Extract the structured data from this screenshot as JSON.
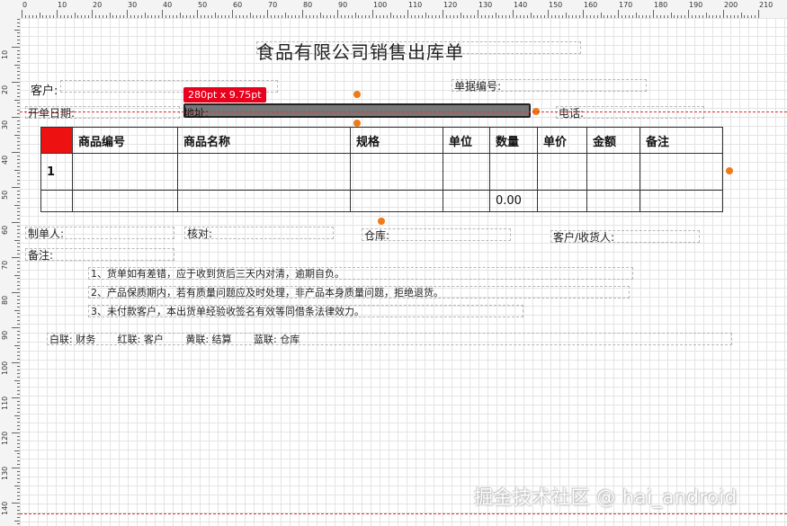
{
  "ruler_top_marks": [
    "0",
    "10",
    "20",
    "30",
    "40",
    "50",
    "60",
    "70",
    "80",
    "90",
    "100",
    "110",
    "120",
    "130",
    "140",
    "150",
    "160",
    "170",
    "180",
    "190",
    "200",
    "210"
  ],
  "ruler_left_marks": [
    "10",
    "20",
    "30",
    "40",
    "50",
    "60",
    "70",
    "80",
    "90",
    "100",
    "110",
    "120",
    "130",
    "140"
  ],
  "report": {
    "title": "食品有限公司销售出库单",
    "customer_label": "客户:",
    "doc_no_label": "单据编号:",
    "date_label": "开单日期:",
    "address_label": "地址:",
    "phone_label": "电话:",
    "size_badge": "280pt x 9.75pt",
    "table": {
      "headers": [
        "",
        "商品编号",
        "商品名称",
        "规格",
        "单位",
        "数量",
        "单价",
        "金额",
        "备注"
      ],
      "row1_index": "1",
      "total_qty": "0.00"
    },
    "maker_label": "制单人:",
    "checker_label": "核对:",
    "warehouse_label": "仓库:",
    "receiver_label": "客户/收货人:",
    "remark_label": "备注:",
    "notes": [
      "1、货单如有差错，应于收到货后三天内对清，逾期自负。",
      "2、产品保质期内，若有质量问题应及时处理，非产品本身质量问题，拒绝退货。",
      "3、未付款客户，本出货单经验收签名有效等同借条法律效力。"
    ],
    "copies": "白联: 财务       红联: 客户       黄联: 结算       蓝联: 仓库"
  },
  "watermark": "掘金技术社区 @ hai_android",
  "colors": {
    "handle": "#ee7a18",
    "badge": "#e8001c",
    "guide": "#e0312f",
    "selection": "#777777"
  }
}
